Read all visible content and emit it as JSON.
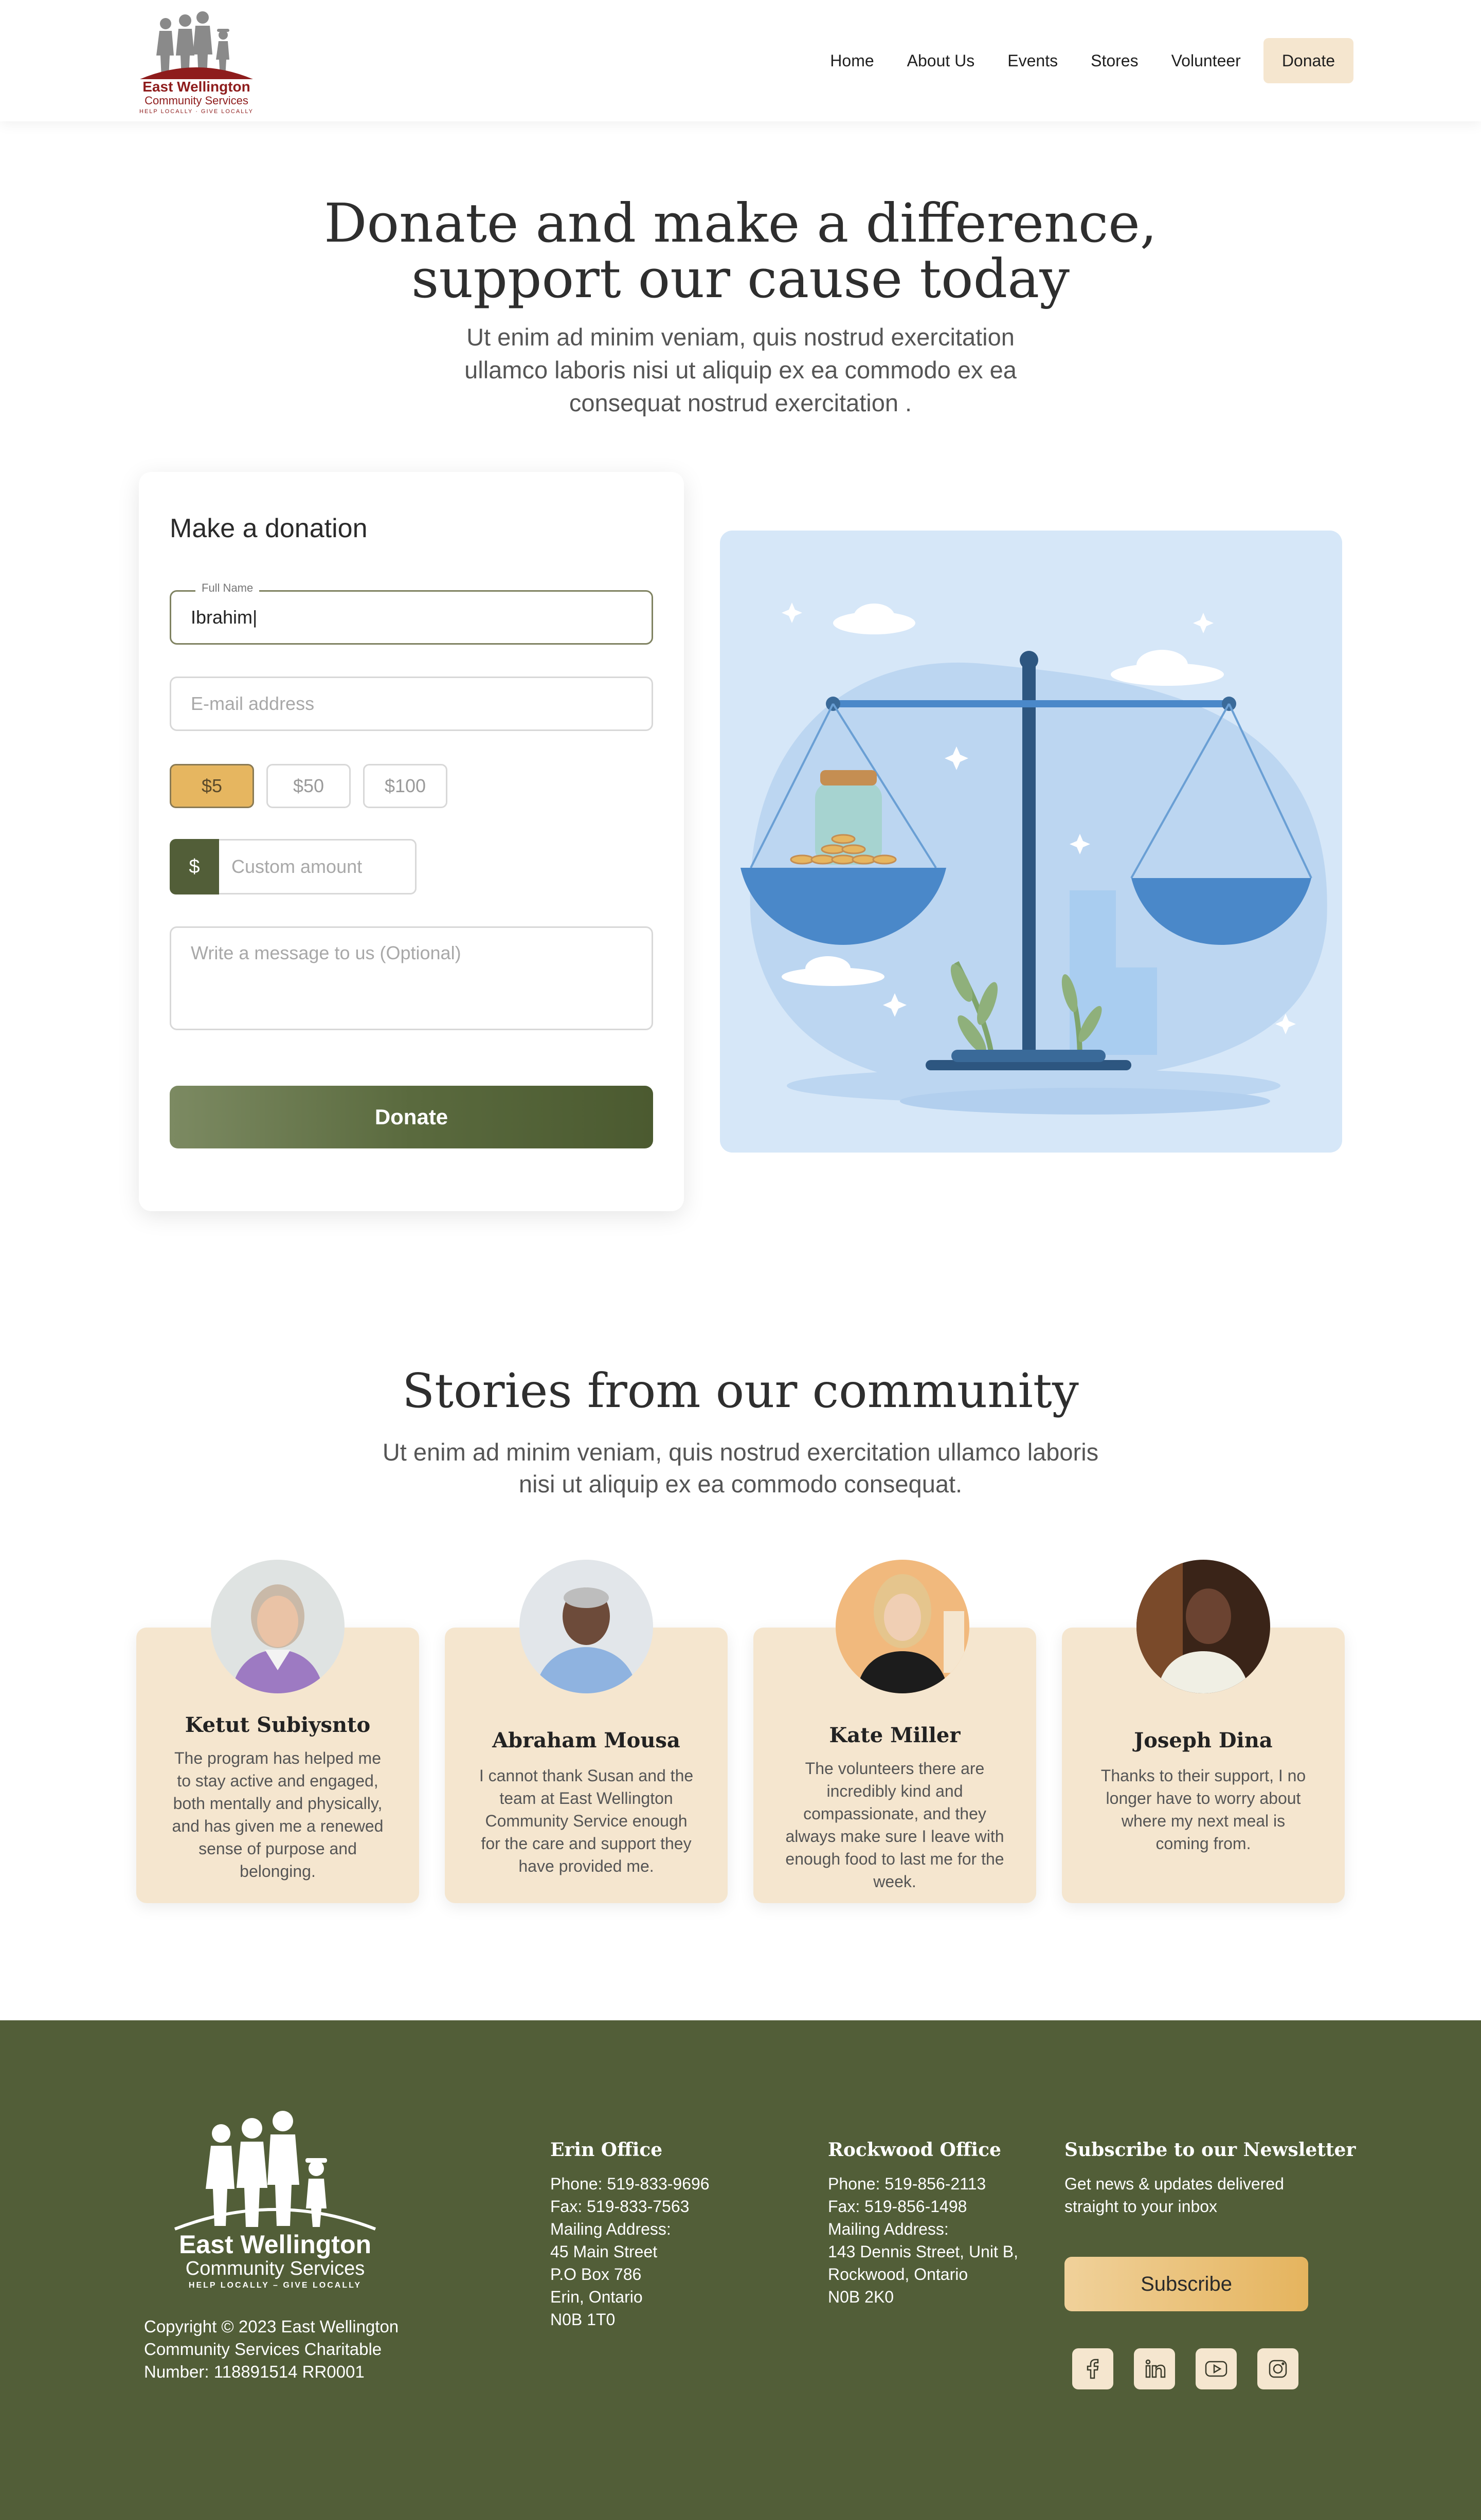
{
  "header": {
    "logo": {
      "line1": "East Wellington",
      "line2": "Community Services",
      "line3": "HELP LOCALLY · GIVE LOCALLY"
    },
    "nav": [
      "Home",
      "About Us",
      "Events",
      "Stores",
      "Volunteer"
    ],
    "donate_label": "Donate"
  },
  "hero": {
    "title_line1": "Donate and make a difference,",
    "title_line2": "support our cause today",
    "subtitle": "Ut enim ad minim veniam, quis nostrud exercitation ullamco laboris nisi ut aliquip ex ea commodo ex ea consequat nostrud exercitation ."
  },
  "donation_form": {
    "title": "Make a donation",
    "full_name": {
      "legend": "Full Name",
      "value": "Ibrahim|"
    },
    "email": {
      "placeholder": "E-mail address"
    },
    "amounts": [
      "$5",
      "$50",
      "$100"
    ],
    "selected_amount": "$5",
    "currency_symbol": "$",
    "custom_amount": {
      "placeholder": "Custom amount"
    },
    "message": {
      "placeholder": "Write a message to us (Optional)"
    },
    "submit_label": "Donate"
  },
  "stories": {
    "title": "Stories from our community",
    "subtitle": "Ut enim ad minim veniam, quis nostrud exercitation ullamco laboris nisi ut aliquip ex ea commodo consequat.",
    "items": [
      {
        "name": "Ketut Subiysnto",
        "text": "The program has helped me to stay active and engaged, both mentally and physically, and has given me a renewed sense of purpose and belonging."
      },
      {
        "name": "Abraham Mousa",
        "text": "I cannot thank Susan and the team at East Wellington Community Service enough for the care and support they have provided me."
      },
      {
        "name": "Kate Miller",
        "text": "The volunteers there are incredibly kind and compassionate, and they always make sure I leave with enough food to last me for the week."
      },
      {
        "name": "Joseph Dina",
        "text": "Thanks to their support, I no longer have to worry about where my next meal is coming from."
      }
    ]
  },
  "footer": {
    "logo": {
      "line1": "East Wellington",
      "line2": "Community Services",
      "line3": "HELP LOCALLY  –  GIVE LOCALLY"
    },
    "copyright": "Copyright © 2023 East Wellington Community Services Charitable Number: 118891514 RR0001",
    "erin": {
      "title": "Erin Office",
      "lines": [
        "Phone: 519-833-9696",
        "Fax: 519-833-7563",
        "Mailing Address:",
        "45 Main Street",
        "P.O Box 786",
        "Erin, Ontario",
        "N0B 1T0"
      ]
    },
    "rockwood": {
      "title": "Rockwood Office",
      "lines": [
        "Phone: 519-856-2113",
        "Fax: 519-856-1498",
        "Mailing Address:",
        "143 Dennis Street, Unit B,",
        "Rockwood, Ontario",
        "N0B 2K0"
      ]
    },
    "newsletter": {
      "title": "Subscribe to our Newsletter",
      "text_line1": "Get news & updates delivered",
      "text_line2": "straight to your inbox",
      "button": "Subscribe"
    },
    "social_icons": [
      "facebook-icon",
      "linkedin-icon",
      "youtube-icon",
      "instagram-icon"
    ]
  },
  "colors": {
    "primary_green": "#525e38",
    "accent_gold": "#e6b660",
    "cream": "#f5e6cf",
    "brand_red": "#8e1c1c"
  }
}
